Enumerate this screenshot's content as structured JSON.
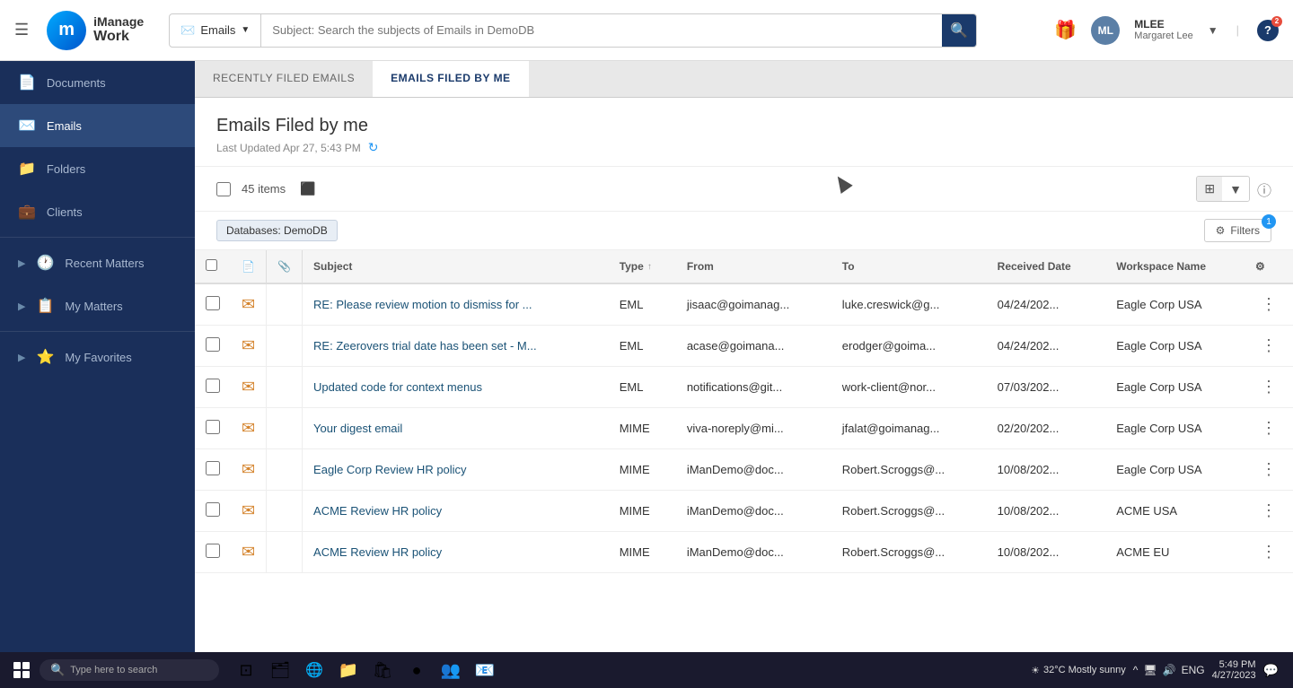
{
  "app": {
    "name": "iManage Work",
    "logo_letter": "m"
  },
  "topbar": {
    "search_placeholder": "Subject: Search the subjects of Emails in DemoDB",
    "search_type": "Emails",
    "user_initials": "ML",
    "user_code": "MLEE",
    "user_name": "Margaret Lee",
    "help_badge": "2"
  },
  "sidebar": {
    "items": [
      {
        "id": "documents",
        "label": "Documents",
        "icon": "📄",
        "active": false
      },
      {
        "id": "emails",
        "label": "Emails",
        "icon": "✉️",
        "active": true
      },
      {
        "id": "folders",
        "label": "Folders",
        "icon": "📁",
        "active": false
      },
      {
        "id": "clients",
        "label": "Clients",
        "icon": "💼",
        "active": false
      },
      {
        "id": "recent-matters",
        "label": "Recent Matters",
        "icon": "🕐",
        "active": false,
        "expandable": true
      },
      {
        "id": "my-matters",
        "label": "My Matters",
        "icon": "📋",
        "active": false,
        "expandable": true
      },
      {
        "id": "my-favorites",
        "label": "My Favorites",
        "icon": "⭐",
        "active": false,
        "expandable": true
      }
    ]
  },
  "tabs": [
    {
      "id": "recently-filed",
      "label": "Recently Filed Emails",
      "active": false
    },
    {
      "id": "filed-by-me",
      "label": "Emails Filed by Me",
      "active": true
    }
  ],
  "page": {
    "title": "Emails Filed by me",
    "subtitle": "Last Updated Apr 27, 5:43 PM",
    "item_count": "45 items"
  },
  "filter": {
    "active_filter": "Databases: DemoDB",
    "filters_label": "Filters",
    "filter_count": "1"
  },
  "columns": [
    {
      "id": "subject",
      "label": "Subject",
      "sortable": true,
      "sort_active": false
    },
    {
      "id": "type",
      "label": "Type",
      "sortable": true,
      "sort_active": true,
      "sort_dir": "asc"
    },
    {
      "id": "from",
      "label": "From",
      "sortable": false
    },
    {
      "id": "to",
      "label": "To",
      "sortable": false
    },
    {
      "id": "received_date",
      "label": "Received Date",
      "sortable": false
    },
    {
      "id": "workspace_name",
      "label": "Workspace Name",
      "sortable": false
    }
  ],
  "emails": [
    {
      "id": 1,
      "subject": "RE: Please review motion to dismiss for ...",
      "type": "EML",
      "from": "jisaac@goimanag...",
      "to": "luke.creswick@g...",
      "received_date": "04/24/202...",
      "workspace": "Eagle Corp USA"
    },
    {
      "id": 2,
      "subject": "RE: Zeerovers trial date has been set - M...",
      "type": "EML",
      "from": "acase@goimana...",
      "to": "erodger@goima...",
      "received_date": "04/24/202...",
      "workspace": "Eagle Corp USA"
    },
    {
      "id": 3,
      "subject": "Updated code for context menus",
      "type": "EML",
      "from": "notifications@git...",
      "to": "work-client@nor...",
      "received_date": "07/03/202...",
      "workspace": "Eagle Corp USA"
    },
    {
      "id": 4,
      "subject": "Your digest email",
      "type": "MIME",
      "from": "viva-noreply@mi...",
      "to": "jfalat@goimanag...",
      "received_date": "02/20/202...",
      "workspace": "Eagle Corp USA"
    },
    {
      "id": 5,
      "subject": "Eagle Corp Review HR policy",
      "type": "MIME",
      "from": "iManDemo@doc...",
      "to": "Robert.Scroggs@...",
      "received_date": "10/08/202...",
      "workspace": "Eagle Corp USA"
    },
    {
      "id": 6,
      "subject": "ACME Review HR policy",
      "type": "MIME",
      "from": "iManDemo@doc...",
      "to": "Robert.Scroggs@...",
      "received_date": "10/08/202...",
      "workspace": "ACME USA"
    },
    {
      "id": 7,
      "subject": "ACME Review HR policy",
      "type": "MIME",
      "from": "iManDemo@doc...",
      "to": "Robert.Scroggs@...",
      "received_date": "10/08/202...",
      "workspace": "ACME EU"
    }
  ],
  "taskbar": {
    "search_placeholder": "Type here to search",
    "weather": "32°C  Mostly sunny",
    "time": "5:49 PM",
    "date": "4/27/2023",
    "language": "ENG"
  }
}
